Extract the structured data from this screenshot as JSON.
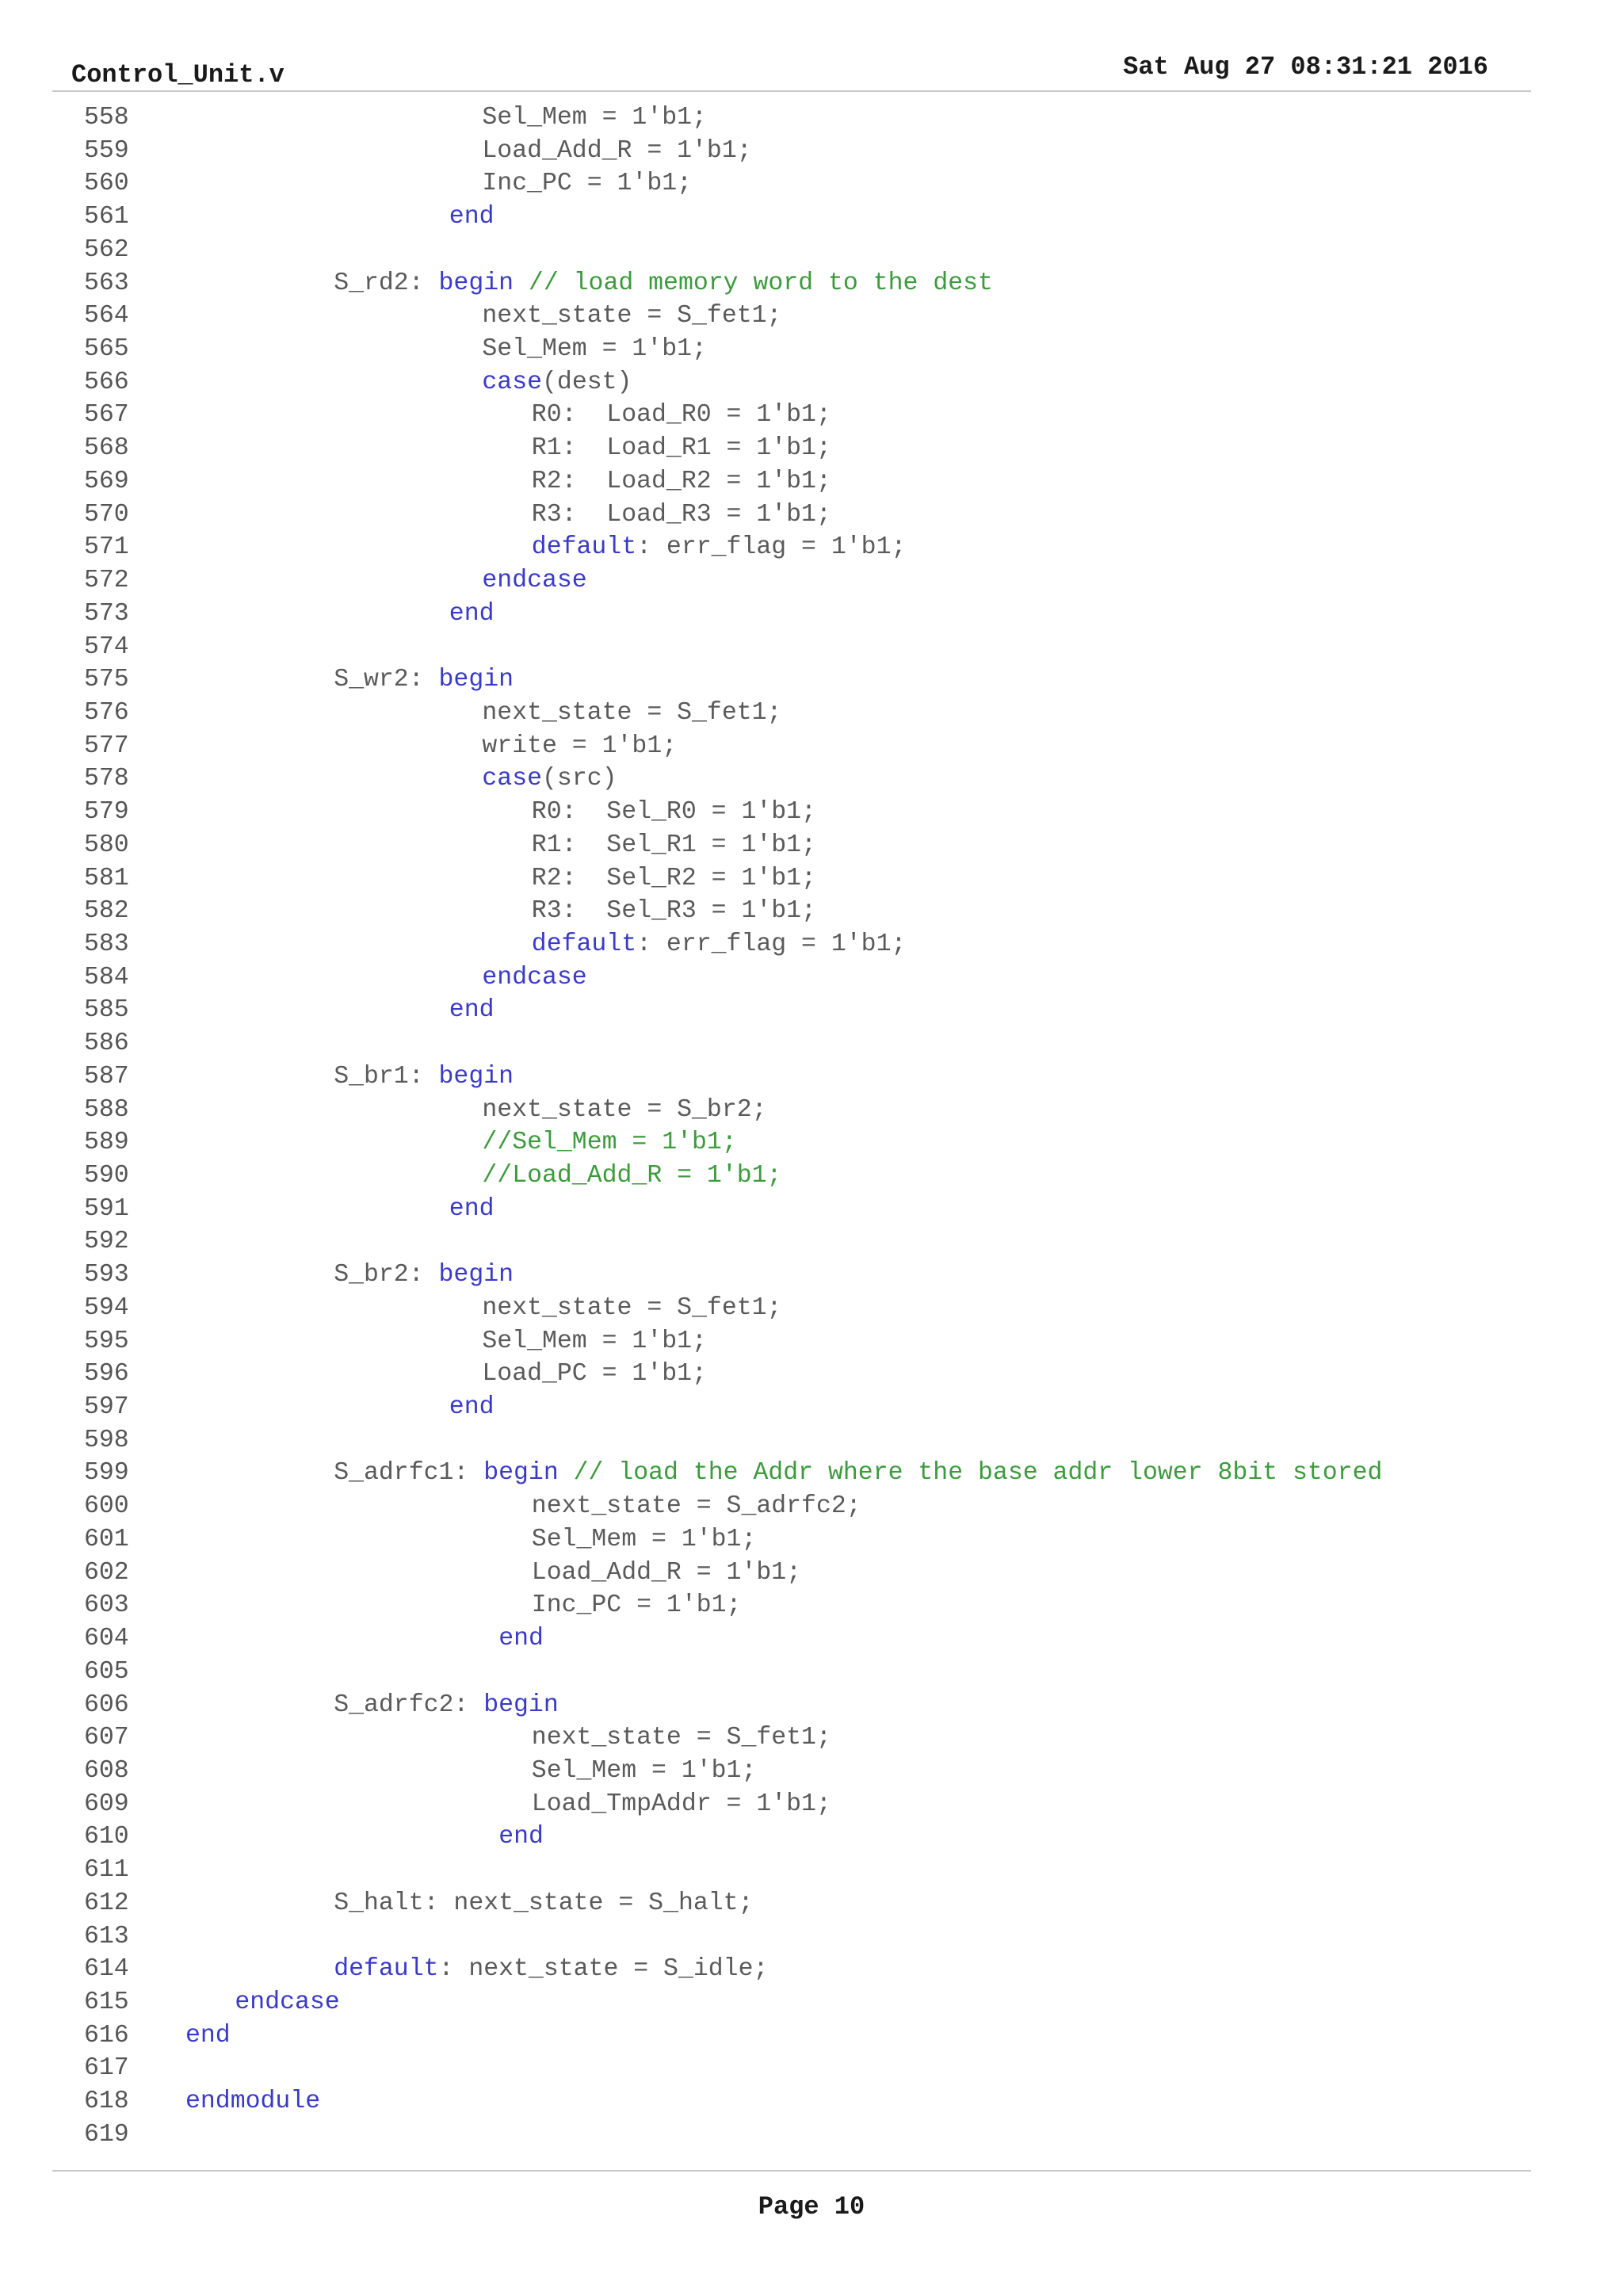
{
  "header": {
    "file_name": "Control_Unit.v",
    "timestamp": "Sat Aug 27 08:31:21 2016"
  },
  "footer": {
    "page_label": "Page 10"
  },
  "lines": [
    {
      "n": "558",
      "indent": 18,
      "segs": [
        {
          "t": "Sel_Mem = 1'b1;",
          "c": "pl"
        }
      ]
    },
    {
      "n": "559",
      "indent": 18,
      "segs": [
        {
          "t": "Load_Add_R = 1'b1;",
          "c": "pl"
        }
      ]
    },
    {
      "n": "560",
      "indent": 18,
      "segs": [
        {
          "t": "Inc_PC = 1'b1;",
          "c": "pl"
        }
      ]
    },
    {
      "n": "561",
      "indent": 16,
      "segs": [
        {
          "t": "end",
          "c": "kw"
        }
      ]
    },
    {
      "n": "562",
      "indent": 0,
      "segs": []
    },
    {
      "n": "563",
      "indent": 9,
      "segs": [
        {
          "t": "S_rd2: ",
          "c": "pl"
        },
        {
          "t": "begin",
          "c": "kw"
        },
        {
          "t": " // load memory word to the dest",
          "c": "cm"
        }
      ]
    },
    {
      "n": "564",
      "indent": 18,
      "segs": [
        {
          "t": "next_state = S_fet1;",
          "c": "pl"
        }
      ]
    },
    {
      "n": "565",
      "indent": 18,
      "segs": [
        {
          "t": "Sel_Mem = 1'b1;",
          "c": "pl"
        }
      ]
    },
    {
      "n": "566",
      "indent": 18,
      "segs": [
        {
          "t": "case",
          "c": "kw"
        },
        {
          "t": "(dest)",
          "c": "pl"
        }
      ]
    },
    {
      "n": "567",
      "indent": 21,
      "segs": [
        {
          "t": "R0:  Load_R0 = 1'b1;",
          "c": "pl"
        }
      ]
    },
    {
      "n": "568",
      "indent": 21,
      "segs": [
        {
          "t": "R1:  Load_R1 = 1'b1;",
          "c": "pl"
        }
      ]
    },
    {
      "n": "569",
      "indent": 21,
      "segs": [
        {
          "t": "R2:  Load_R2 = 1'b1;",
          "c": "pl"
        }
      ]
    },
    {
      "n": "570",
      "indent": 21,
      "segs": [
        {
          "t": "R3:  Load_R3 = 1'b1;",
          "c": "pl"
        }
      ]
    },
    {
      "n": "571",
      "indent": 21,
      "segs": [
        {
          "t": "default",
          "c": "kw"
        },
        {
          "t": ": err_flag = 1'b1;",
          "c": "pl"
        }
      ]
    },
    {
      "n": "572",
      "indent": 18,
      "segs": [
        {
          "t": "endcase",
          "c": "kw"
        }
      ]
    },
    {
      "n": "573",
      "indent": 16,
      "segs": [
        {
          "t": "end",
          "c": "kw"
        }
      ]
    },
    {
      "n": "574",
      "indent": 0,
      "segs": []
    },
    {
      "n": "575",
      "indent": 9,
      "segs": [
        {
          "t": "S_wr2: ",
          "c": "pl"
        },
        {
          "t": "begin",
          "c": "kw"
        }
      ]
    },
    {
      "n": "576",
      "indent": 18,
      "segs": [
        {
          "t": "next_state = S_fet1;",
          "c": "pl"
        }
      ]
    },
    {
      "n": "577",
      "indent": 18,
      "segs": [
        {
          "t": "write = 1'b1;",
          "c": "pl"
        }
      ]
    },
    {
      "n": "578",
      "indent": 18,
      "segs": [
        {
          "t": "case",
          "c": "kw"
        },
        {
          "t": "(src)",
          "c": "pl"
        }
      ]
    },
    {
      "n": "579",
      "indent": 21,
      "segs": [
        {
          "t": "R0:  Sel_R0 = 1'b1;",
          "c": "pl"
        }
      ]
    },
    {
      "n": "580",
      "indent": 21,
      "segs": [
        {
          "t": "R1:  Sel_R1 = 1'b1;",
          "c": "pl"
        }
      ]
    },
    {
      "n": "581",
      "indent": 21,
      "segs": [
        {
          "t": "R2:  Sel_R2 = 1'b1;",
          "c": "pl"
        }
      ]
    },
    {
      "n": "582",
      "indent": 21,
      "segs": [
        {
          "t": "R3:  Sel_R3 = 1'b1;",
          "c": "pl"
        }
      ]
    },
    {
      "n": "583",
      "indent": 21,
      "segs": [
        {
          "t": "default",
          "c": "kw"
        },
        {
          "t": ": err_flag = 1'b1;",
          "c": "pl"
        }
      ]
    },
    {
      "n": "584",
      "indent": 18,
      "segs": [
        {
          "t": "endcase",
          "c": "kw"
        }
      ]
    },
    {
      "n": "585",
      "indent": 16,
      "segs": [
        {
          "t": "end",
          "c": "kw"
        }
      ]
    },
    {
      "n": "586",
      "indent": 0,
      "segs": []
    },
    {
      "n": "587",
      "indent": 9,
      "segs": [
        {
          "t": "S_br1: ",
          "c": "pl"
        },
        {
          "t": "begin",
          "c": "kw"
        }
      ]
    },
    {
      "n": "588",
      "indent": 18,
      "segs": [
        {
          "t": "next_state = S_br2;",
          "c": "pl"
        }
      ]
    },
    {
      "n": "589",
      "indent": 18,
      "segs": [
        {
          "t": "//Sel_Mem = 1'b1;",
          "c": "cm"
        }
      ]
    },
    {
      "n": "590",
      "indent": 18,
      "segs": [
        {
          "t": "//Load_Add_R = 1'b1;",
          "c": "cm"
        }
      ]
    },
    {
      "n": "591",
      "indent": 16,
      "segs": [
        {
          "t": "end",
          "c": "kw"
        }
      ]
    },
    {
      "n": "592",
      "indent": 0,
      "segs": []
    },
    {
      "n": "593",
      "indent": 9,
      "segs": [
        {
          "t": "S_br2: ",
          "c": "pl"
        },
        {
          "t": "begin",
          "c": "kw"
        }
      ]
    },
    {
      "n": "594",
      "indent": 18,
      "segs": [
        {
          "t": "next_state = S_fet1;",
          "c": "pl"
        }
      ]
    },
    {
      "n": "595",
      "indent": 18,
      "segs": [
        {
          "t": "Sel_Mem = 1'b1;",
          "c": "pl"
        }
      ]
    },
    {
      "n": "596",
      "indent": 18,
      "segs": [
        {
          "t": "Load_PC = 1'b1;",
          "c": "pl"
        }
      ]
    },
    {
      "n": "597",
      "indent": 16,
      "segs": [
        {
          "t": "end",
          "c": "kw"
        }
      ]
    },
    {
      "n": "598",
      "indent": 0,
      "segs": []
    },
    {
      "n": "599",
      "indent": 9,
      "segs": [
        {
          "t": "S_adrfc1: ",
          "c": "pl"
        },
        {
          "t": "begin",
          "c": "kw"
        },
        {
          "t": " // load the Addr where the base addr lower 8bit stored",
          "c": "cm"
        }
      ]
    },
    {
      "n": "600",
      "indent": 21,
      "segs": [
        {
          "t": "next_state = S_adrfc2;",
          "c": "pl"
        }
      ]
    },
    {
      "n": "601",
      "indent": 21,
      "segs": [
        {
          "t": "Sel_Mem = 1'b1;",
          "c": "pl"
        }
      ]
    },
    {
      "n": "602",
      "indent": 21,
      "segs": [
        {
          "t": "Load_Add_R = 1'b1;",
          "c": "pl"
        }
      ]
    },
    {
      "n": "603",
      "indent": 21,
      "segs": [
        {
          "t": "Inc_PC = 1'b1;",
          "c": "pl"
        }
      ]
    },
    {
      "n": "604",
      "indent": 19,
      "segs": [
        {
          "t": "end",
          "c": "kw"
        }
      ]
    },
    {
      "n": "605",
      "indent": 0,
      "segs": []
    },
    {
      "n": "606",
      "indent": 9,
      "segs": [
        {
          "t": "S_adrfc2: ",
          "c": "pl"
        },
        {
          "t": "begin",
          "c": "kw"
        }
      ]
    },
    {
      "n": "607",
      "indent": 21,
      "segs": [
        {
          "t": "next_state = S_fet1;",
          "c": "pl"
        }
      ]
    },
    {
      "n": "608",
      "indent": 21,
      "segs": [
        {
          "t": "Sel_Mem = 1'b1;",
          "c": "pl"
        }
      ]
    },
    {
      "n": "609",
      "indent": 21,
      "segs": [
        {
          "t": "Load_TmpAddr = 1'b1;",
          "c": "pl"
        }
      ]
    },
    {
      "n": "610",
      "indent": 19,
      "segs": [
        {
          "t": "end",
          "c": "kw"
        }
      ]
    },
    {
      "n": "611",
      "indent": 0,
      "segs": []
    },
    {
      "n": "612",
      "indent": 9,
      "segs": [
        {
          "t": "S_halt: next_state = S_halt;",
          "c": "pl"
        }
      ]
    },
    {
      "n": "613",
      "indent": 0,
      "segs": []
    },
    {
      "n": "614",
      "indent": 9,
      "segs": [
        {
          "t": "default",
          "c": "kw"
        },
        {
          "t": ": next_state = S_idle;",
          "c": "pl"
        }
      ]
    },
    {
      "n": "615",
      "indent": 3,
      "segs": [
        {
          "t": "endcase",
          "c": "kw"
        }
      ]
    },
    {
      "n": "616",
      "indent": 0,
      "segs": [
        {
          "t": "end",
          "c": "kw"
        }
      ]
    },
    {
      "n": "617",
      "indent": 0,
      "segs": []
    },
    {
      "n": "618",
      "indent": 0,
      "segs": [
        {
          "t": "endmodule",
          "c": "kw"
        }
      ]
    },
    {
      "n": "619",
      "indent": 0,
      "segs": []
    }
  ]
}
